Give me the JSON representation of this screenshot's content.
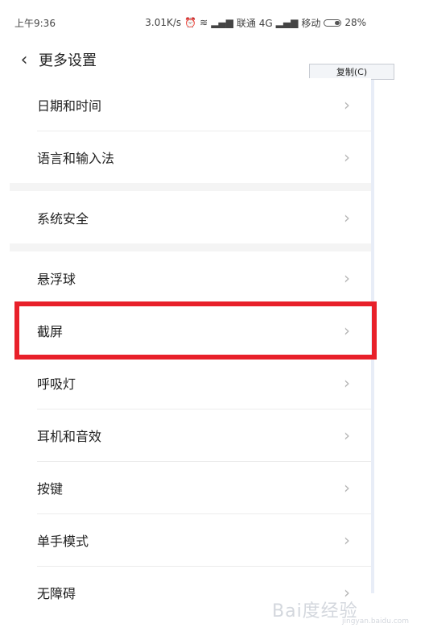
{
  "status": {
    "time": "上午9:36",
    "speed": "3.01K/s",
    "carrier1": "联通 4G",
    "carrier2": "移动",
    "battery": "28%"
  },
  "header": {
    "back_icon": "‹",
    "title": "更多设置"
  },
  "context_menu": {
    "copy_label": "复制(C)"
  },
  "groups": [
    {
      "items": [
        {
          "label": "日期和时间"
        },
        {
          "label": "语言和输入法"
        }
      ]
    },
    {
      "items": [
        {
          "label": "系统安全"
        }
      ]
    },
    {
      "items": [
        {
          "label": "悬浮球"
        },
        {
          "label": "截屏"
        },
        {
          "label": "呼吸灯"
        },
        {
          "label": "耳机和音效"
        },
        {
          "label": "按键"
        },
        {
          "label": "单手模式"
        },
        {
          "label": "无障碍"
        }
      ]
    }
  ],
  "watermark": {
    "logo": "Bai度经验",
    "url": "jingyan.baidu.com"
  },
  "colors": {
    "highlight": "#e8202a",
    "chevron": "#b8b8b8",
    "gap": "#f4f4f4"
  }
}
